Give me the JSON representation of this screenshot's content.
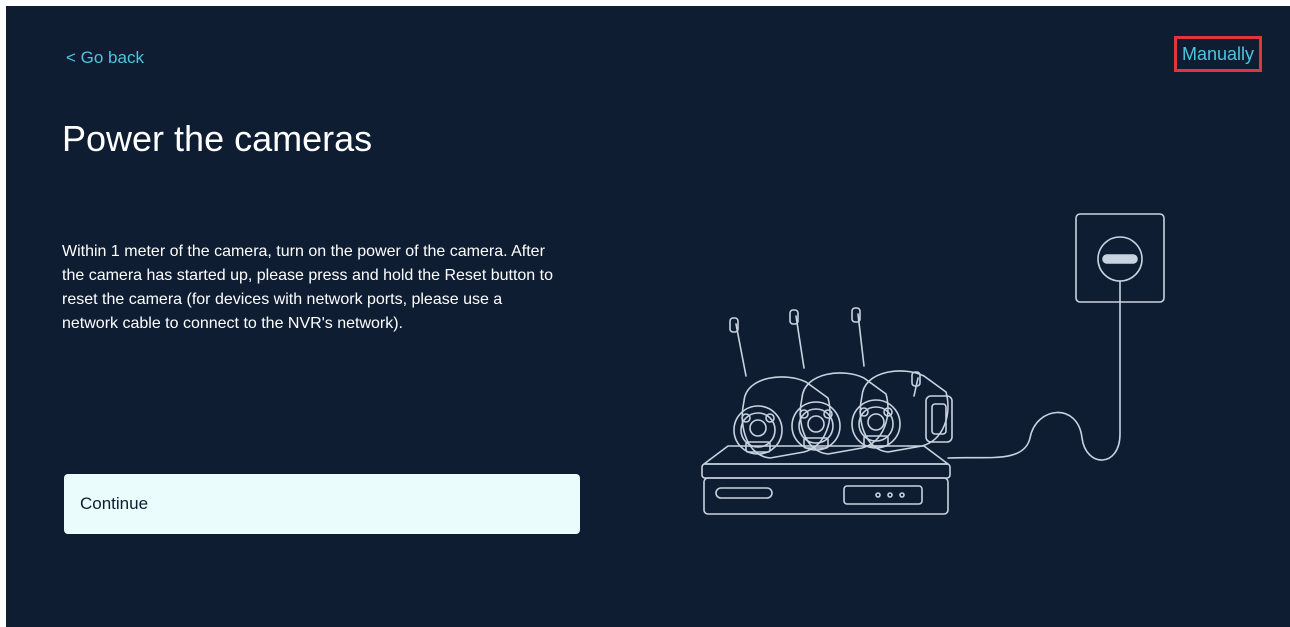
{
  "nav": {
    "go_back_label": "< Go back",
    "manually_label": "Manually"
  },
  "main": {
    "title": "Power the cameras",
    "description": "Within 1 meter of the camera, turn on the power of the camera. After the camera has started up, please press and hold the Reset button to reset the camera (for devices with network ports, please use a network cable to connect to the NVR's network).",
    "continue_label": "Continue"
  },
  "illustration": {
    "icon": "nvr-cameras-power-outlet-illustration"
  },
  "colors": {
    "background": "#0f1d33",
    "link": "#4fc3e0",
    "highlight_border": "#e0353d",
    "button_bg": "#eafcfb"
  }
}
